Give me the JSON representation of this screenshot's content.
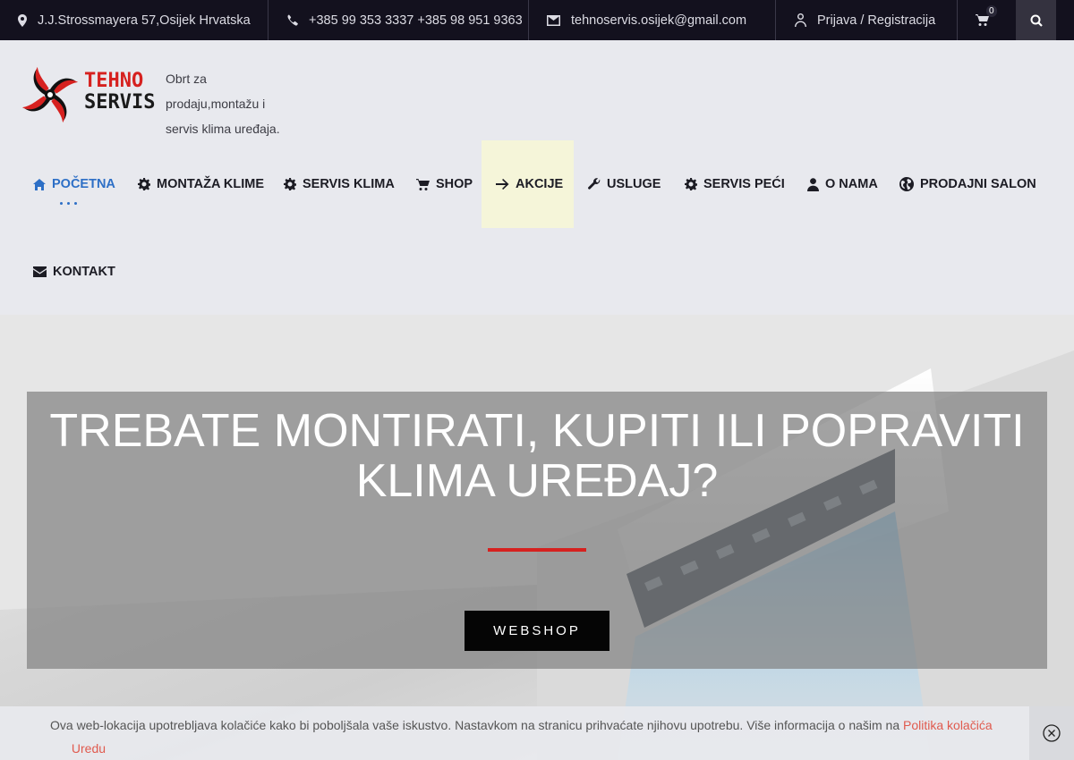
{
  "topbar": {
    "address": "J.J.Strossmayera 57,Osijek Hrvatska",
    "phones": "+385 99 353 3337 +385 98 951 9363",
    "email": "tehnoservis.osijek@gmail.com",
    "account": "Prijava / Registracija",
    "cart_count": "0",
    "icons": [
      "map-pin-icon",
      "phone-icon",
      "envelope-icon",
      "user-icon",
      "cart-icon",
      "search-icon"
    ]
  },
  "brand": {
    "logo_line1": "TEHNO",
    "logo_line2": "SERVIS",
    "tagline": "Obrt za prodaju,montažu i servis klima uređaja.",
    "accent_red": "#d6211f"
  },
  "nav": {
    "items": [
      {
        "label": "POČETNA",
        "icon": "home-icon",
        "active": true
      },
      {
        "label": "MONTAŽA KLIME",
        "icon": "gear-icon"
      },
      {
        "label": "SERVIS KLIMA",
        "icon": "gear-icon"
      },
      {
        "label": "SHOP",
        "icon": "cart-icon"
      },
      {
        "label": "AKCIJE",
        "icon": "arrow-right-icon",
        "highlighted": true
      },
      {
        "label": "USLUGE",
        "icon": "wrench-icon"
      },
      {
        "label": "SERVIS PEĆI",
        "icon": "gear-icon"
      },
      {
        "label": "O NAMA",
        "icon": "user-icon"
      },
      {
        "label": "PRODAJNI SALON",
        "icon": "globe-icon"
      },
      {
        "label": "KONTAKT",
        "icon": "envelope-icon"
      }
    ],
    "active_color": "#2d6fc6"
  },
  "hero": {
    "title": "TREBATE MONTIRATI, KUPITI ILI POPRAVITI KLIMA UREĐAJ?",
    "button": "WEBSHOP"
  },
  "cookie": {
    "text": "Ova web-lokacija upotrebljava kolačiće kako bi poboljšala vaše iskustvo. Nastavkom na stranicu prihvaćate njihovu upotrebu. Više informacija o našim na",
    "policy_link": "Politika kolačića",
    "accept": "Uredu"
  }
}
